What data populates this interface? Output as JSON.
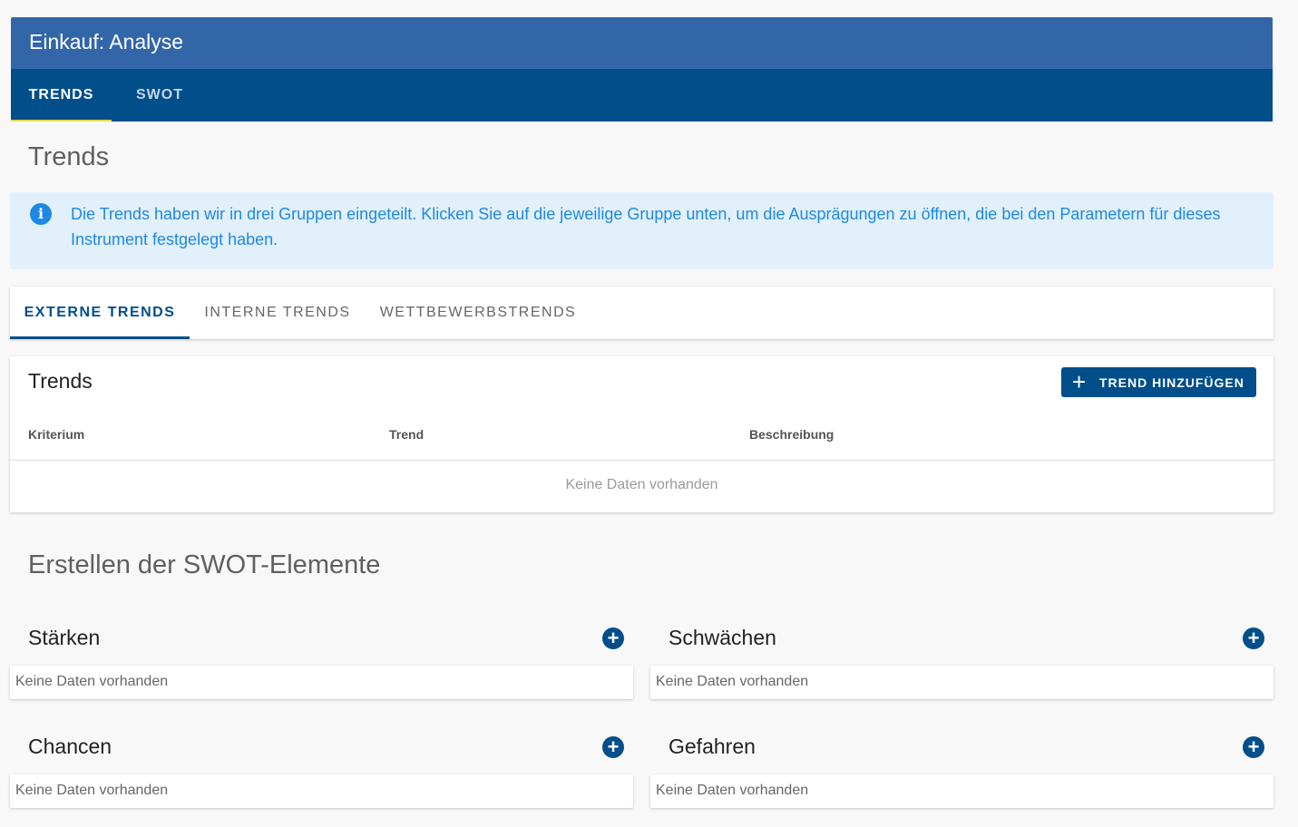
{
  "app": {
    "title": "Einkauf: Analyse"
  },
  "main_tabs": [
    {
      "label": "TRENDS",
      "active": true
    },
    {
      "label": "SWOT",
      "active": false
    }
  ],
  "page": {
    "heading": "Trends"
  },
  "info": {
    "icon": "info-icon",
    "text": "Die Trends haben wir in drei Gruppen eingeteilt. Klicken Sie auf die jeweilige Gruppe unten, um die Ausprägungen zu öffnen, die bei den Parametern für dieses Instrument festgelegt haben."
  },
  "trend_tabs": [
    {
      "label": "EXTERNE TRENDS",
      "active": true
    },
    {
      "label": "INTERNE TRENDS",
      "active": false
    },
    {
      "label": "WETTBEWERBSTRENDS",
      "active": false
    }
  ],
  "trends_table": {
    "title": "Trends",
    "add_button": "TREND HINZUFÜGEN",
    "columns": [
      "Kriterium",
      "Trend",
      "Beschreibung"
    ],
    "empty_text": "Keine Daten vorhanden"
  },
  "swot": {
    "heading": "Erstellen der SWOT-Elemente",
    "sections": [
      {
        "title": "Stärken",
        "empty_text": "Keine Daten vorhanden"
      },
      {
        "title": "Schwächen",
        "empty_text": "Keine Daten vorhanden"
      },
      {
        "title": "Chancen",
        "empty_text": "Keine Daten vorhanden"
      },
      {
        "title": "Gefahren",
        "empty_text": "Keine Daten vorhanden"
      }
    ]
  },
  "colors": {
    "header": "#3366a8",
    "tabbar": "#004e8a",
    "tab_indicator": "#e6d94d",
    "info_bg": "#e2f0fb",
    "info_text": "#1e88e5"
  }
}
